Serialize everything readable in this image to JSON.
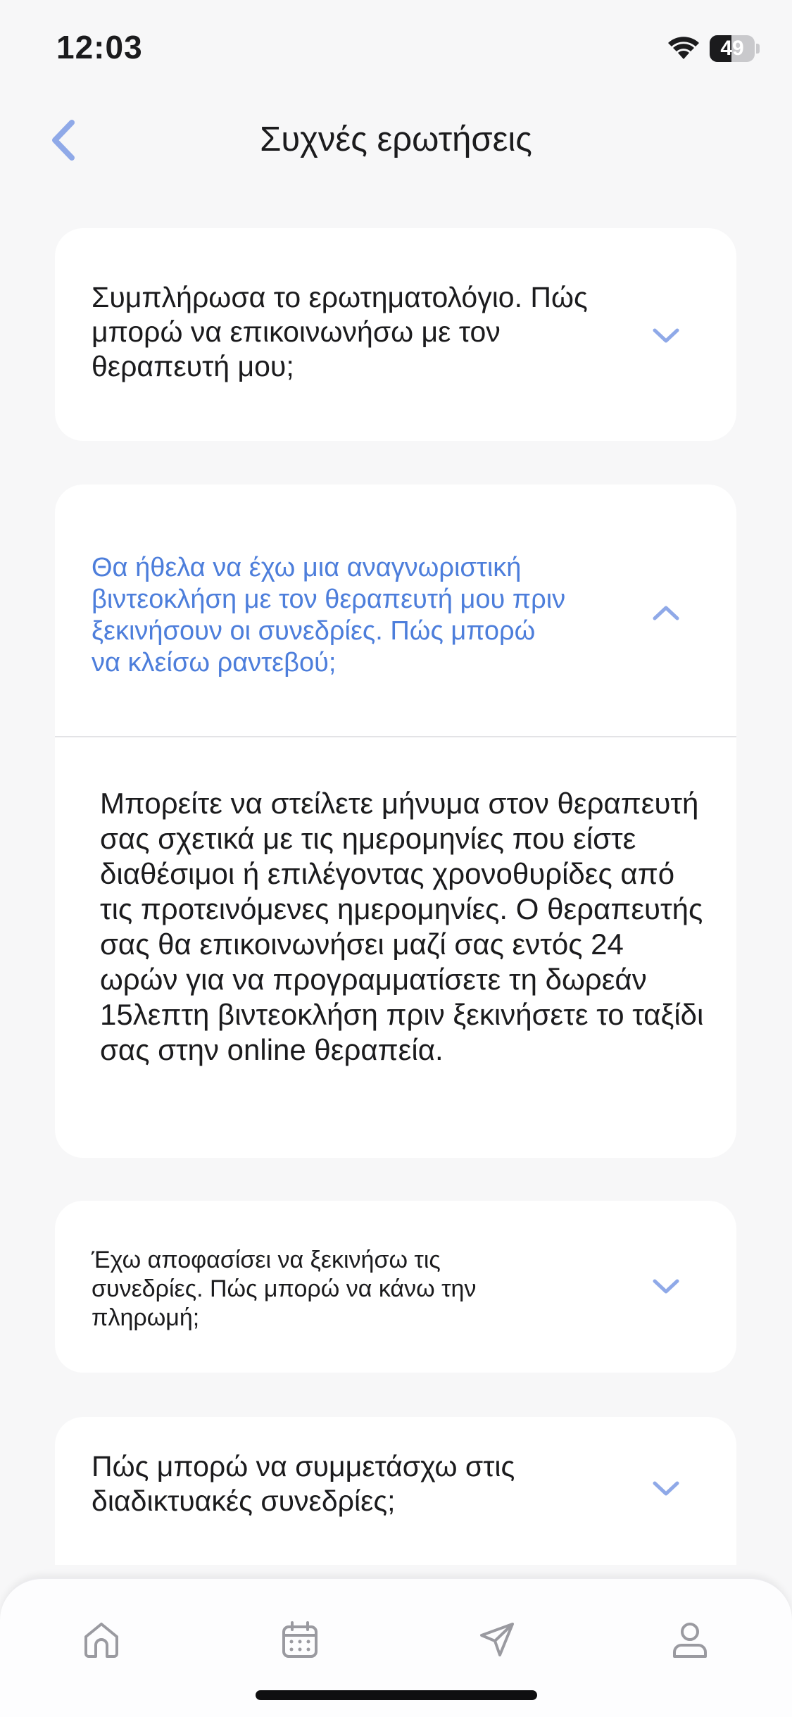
{
  "status_bar": {
    "time": "12:03",
    "battery_percent": "49",
    "battery_level": 0.49
  },
  "header": {
    "title": "Συχνές ερωτήσεις",
    "back_icon": "chevron-left-icon"
  },
  "faq": [
    {
      "question": "Συμπλήρωσα το ερωτηματολόγιο. Πώς μπορώ να επικοινωνήσω με τον θεραπευτή μου;",
      "expanded": false
    },
    {
      "question": "Θα ήθελα να έχω μια αναγνωριστική βιντεοκλήση με τον θεραπευτή μου πριν ξεκινήσουν οι συνεδρίες. Πώς μπορώ να κλείσω ραντεβού;",
      "expanded": true,
      "answer": "Μπορείτε να στείλετε μήνυμα στον θεραπευτή σας σχετικά με τις ημερομηνίες που είστε διαθέσιμοι ή επιλέγοντας χρονοθυρίδες από τις προτεινόμενες ημερομηνίες. Ο θεραπευτής σας θα επικοινωνήσει μαζί σας εντός 24 ωρών για να προγραμματίσετε τη δωρεάν 15λεπτη βιντεοκλήση πριν ξεκινήσετε το ταξίδι σας στην online θεραπεία."
    },
    {
      "question": "Έχω αποφασίσει να ξεκινήσω τις συνεδρίες. Πώς μπορώ να κάνω την πληρωμή;",
      "expanded": false
    },
    {
      "question": "Πώς μπορώ να συμμετάσχω στις διαδικτυακές συνεδρίες;",
      "expanded": false
    }
  ],
  "tab_bar": {
    "icons": [
      "home-icon",
      "calendar-icon",
      "send-icon",
      "profile-icon"
    ]
  },
  "colors": {
    "accent": "#4d7edb",
    "chevron": "#8fa9e8",
    "background": "#f7f7f8"
  }
}
